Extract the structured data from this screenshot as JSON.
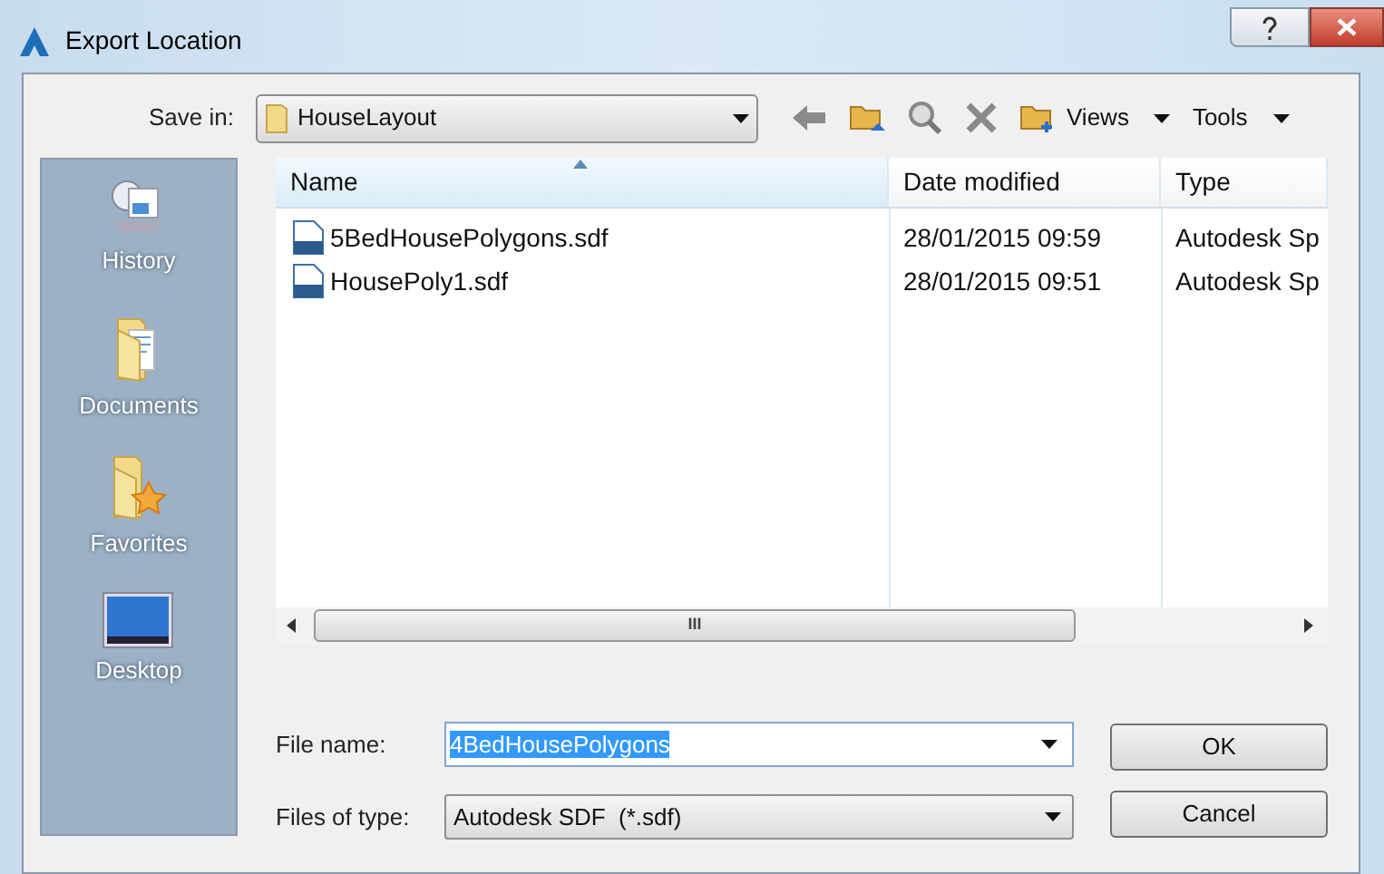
{
  "window": {
    "title": "Export Location"
  },
  "save_in": {
    "label": "Save in:",
    "value": "HouseLayout"
  },
  "toolbar": {
    "views": "Views",
    "tools": "Tools"
  },
  "places": [
    {
      "label": "History",
      "kind": "history"
    },
    {
      "label": "Documents",
      "kind": "documents"
    },
    {
      "label": "Favorites",
      "kind": "favorites"
    },
    {
      "label": "Desktop",
      "kind": "desktop"
    }
  ],
  "table": {
    "columns": [
      {
        "label": "Name",
        "sorted": true
      },
      {
        "label": "Date modified",
        "sorted": false
      },
      {
        "label": "Type",
        "sorted": false
      }
    ],
    "rows": [
      {
        "cells": [
          "5BedHousePolygons.sdf",
          "28/01/2015 09:59",
          "Autodesk Sp"
        ]
      },
      {
        "cells": [
          "HousePoly1.sdf",
          "28/01/2015 09:51",
          "Autodesk Sp"
        ]
      }
    ],
    "scroll_glyph": "III"
  },
  "file_name": {
    "label": "File name:",
    "value": "4BedHousePolygons",
    "selected": true
  },
  "file_type": {
    "label": "Files of type:",
    "value": "Autodesk SDF  (*.sdf)"
  },
  "buttons": [
    "OK",
    "Cancel"
  ]
}
